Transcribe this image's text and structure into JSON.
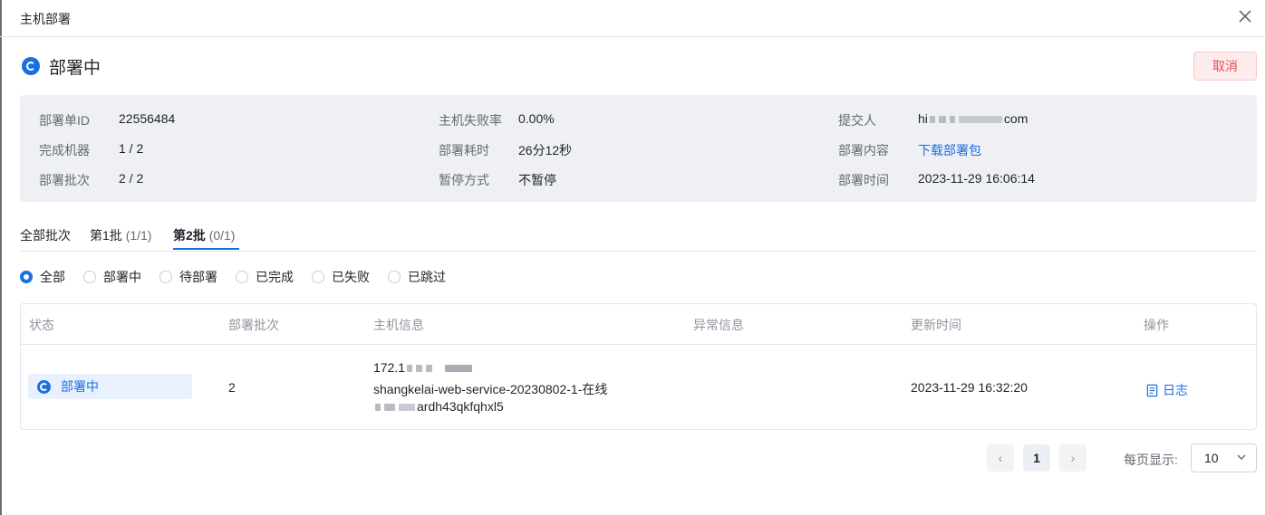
{
  "header": {
    "title": "主机部署"
  },
  "status": {
    "text": "部署中",
    "cancel_label": "取消"
  },
  "info": {
    "col1": [
      {
        "label": "部署单ID",
        "value": "22556484"
      },
      {
        "label": "完成机器",
        "value": "1 / 2"
      },
      {
        "label": "部署批次",
        "value": "2 / 2"
      }
    ],
    "col2": [
      {
        "label": "主机失败率",
        "value": "0.00%"
      },
      {
        "label": "部署耗时",
        "value": "26分12秒"
      },
      {
        "label": "暂停方式",
        "value": "不暂停"
      }
    ],
    "col3": [
      {
        "label": "提交人",
        "value_prefix": "hi",
        "value_suffix": "com"
      },
      {
        "label": "部署内容",
        "value": "下载部署包"
      },
      {
        "label": "部署时间",
        "value": "2023-11-29 16:06:14"
      }
    ]
  },
  "tabs": [
    {
      "label": "全部批次",
      "count": ""
    },
    {
      "label": "第1批",
      "count": "(1/1)"
    },
    {
      "label": "第2批",
      "count": "(0/1)"
    }
  ],
  "filters": [
    "全部",
    "部署中",
    "待部署",
    "已完成",
    "已失败",
    "已跳过"
  ],
  "table": {
    "columns": [
      "状态",
      "部署批次",
      "主机信息",
      "异常信息",
      "更新时间",
      "操作"
    ],
    "rows": [
      {
        "status": "部署中",
        "batch": "2",
        "host_ip_prefix": "172.1",
        "host_service": "shangkelai-web-service-20230802-1-在线",
        "host_id_suffix": "ardh43qkfqhxl5",
        "error": "",
        "updated": "2023-11-29 16:32:20",
        "action": "日志"
      }
    ]
  },
  "pagination": {
    "prev": "‹",
    "current": "1",
    "next": "›",
    "per_page_label": "每页显示:",
    "per_page": "10"
  },
  "colors": {
    "accent": "#1a6fdf",
    "danger": "#e34d59",
    "info_bg": "#eef0f4"
  }
}
